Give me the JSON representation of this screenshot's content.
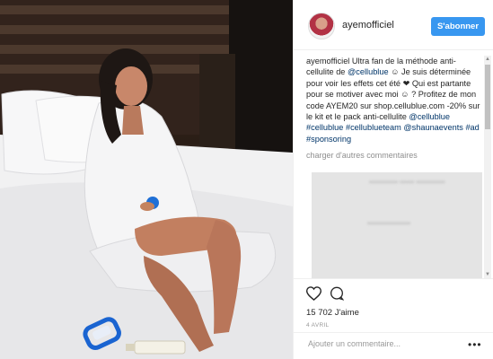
{
  "post": {
    "username": "ayemofficiel",
    "follow_label": "S'abonner",
    "caption_user": "ayemofficiel",
    "caption_text_1": " Ultra fan de la méthode anti-cellulite de ",
    "mention_1": "@cellublue",
    "caption_text_2": " ☺ Je suis déterminée pour voir les effets cet été ❤ Qui est partante pour se motiver avec moi ☺ ? Profitez de mon code AYEM20 sur shop.cellublue.com -20% sur le kit et le pack anti-cellulite ",
    "mention_2": "@cellublue",
    "space_1": " ",
    "hashtag_1": "#cellublue",
    "space_2": " ",
    "hashtag_2": "#cellublueteam",
    "space_3": " ",
    "mention_3": "@shaunaevents",
    "space_4": " ",
    "hashtag_3": "#ad",
    "space_5": " ",
    "hashtag_4": "#sponsoring",
    "more_comments": "charger d'autres commentaires",
    "likes": "15 702 J'aime",
    "date": "4 AVRIL",
    "add_comment_placeholder": "Ajouter un commentaire..."
  },
  "icons": {
    "avatar": "profile-avatar",
    "like": "heart-icon",
    "comment": "comment-bubble-icon",
    "more": "more-options-icon"
  },
  "colors": {
    "follow_button": "#3897f0",
    "link": "#003569",
    "muted": "#8e8e8e"
  }
}
